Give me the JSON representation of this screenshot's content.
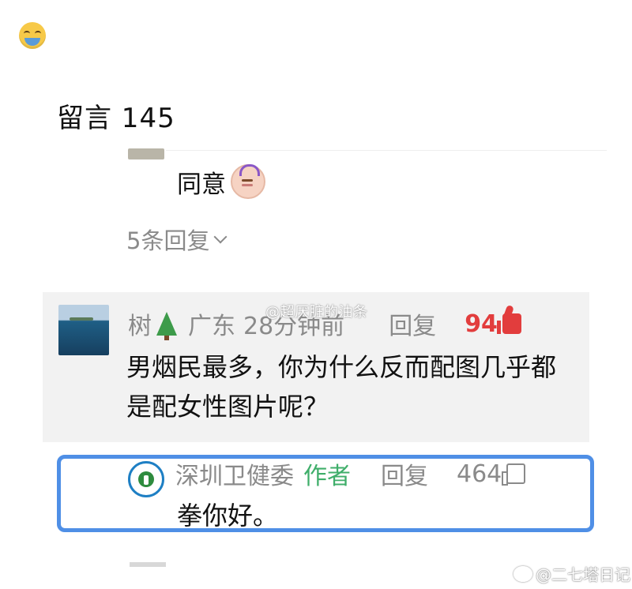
{
  "header": {
    "title": "留言 145"
  },
  "previous_comment": {
    "text": "同意",
    "emoji": "hands-over-head-emoji",
    "replies_label": "5条回复"
  },
  "comment": {
    "username": "树",
    "region": "广东",
    "time": "28分钟前",
    "reply_label": "回复",
    "likes": "94",
    "text": "男烟民最多，你为什么反而配图几乎都是配女性图片呢？",
    "watermark": "@超厌脏的油条"
  },
  "author_reply": {
    "username": "深圳卫健委",
    "tag": "作者",
    "reply_label": "回复",
    "likes": "464",
    "text": "拳你好。"
  },
  "footer": {
    "watermark": "@二七塔日记"
  },
  "colors": {
    "like_active": "#e23d3d",
    "author_tag": "#3fae6a",
    "highlight_box": "#4f8fe6",
    "meta_gray": "#8a8a8a"
  }
}
